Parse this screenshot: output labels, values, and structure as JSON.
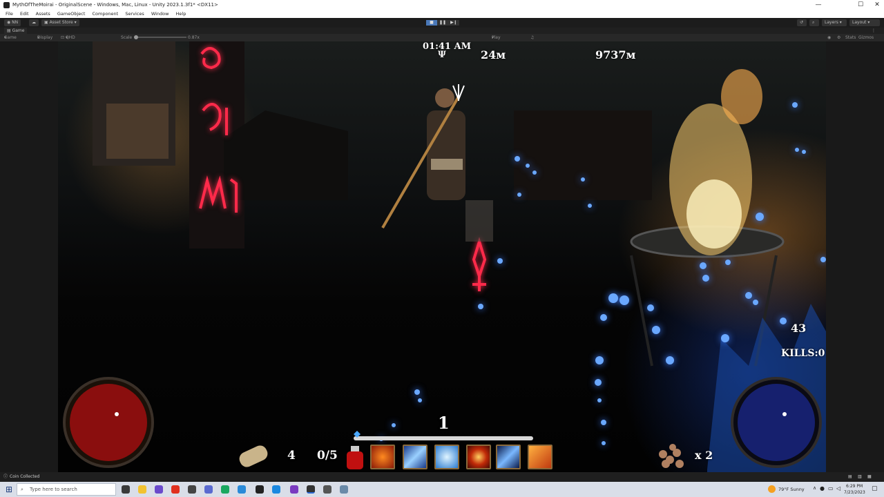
{
  "window": {
    "title": "MythOfTheMoirai - OriginalScene - Windows, Mac, Linux - Unity 2023.1.3f1* <DX11>",
    "minimize": "—",
    "maximize": "☐",
    "close": "✕"
  },
  "menu": [
    "File",
    "Edit",
    "Assets",
    "GameObject",
    "Component",
    "Services",
    "Window",
    "Help"
  ],
  "toolbar": {
    "account": "NN",
    "asset_store": "Asset Store",
    "layers": "Layers",
    "layout": "Layout"
  },
  "game_tab": {
    "label": "Game"
  },
  "gamebar": {
    "mode": "Game",
    "display": "Display 1",
    "resolution": "QHD (2560x1440)",
    "scale_label": "Scale",
    "scale_value": "0.87x",
    "play_focused": "Play Focused",
    "stats": "Stats",
    "gizmos": "Gizmos"
  },
  "hud": {
    "time": "01:41 AM",
    "depth": "24м",
    "distance": "9737м",
    "level": "1",
    "scrolls": "4",
    "potions": "0/5",
    "ammo": "43",
    "kills": "KILLS:0",
    "coins": "x 2"
  },
  "skills": [
    "fire-skill-icon",
    "lightning-skill-icon",
    "frost-skill-icon",
    "fire-swirl-skill-icon",
    "storm-skill-icon",
    "blade-skill-icon"
  ],
  "status": {
    "message": "Coin Collected"
  },
  "taskbar": {
    "search_placeholder": "Type here to search",
    "weather": "79°F  Sunny",
    "time": "6:29 PM",
    "date": "7/23/2023"
  },
  "colors": {
    "rune": "#ff2a4a",
    "mana": "#1a2a9a",
    "health": "#a01010",
    "particle": "#3a7bff"
  }
}
